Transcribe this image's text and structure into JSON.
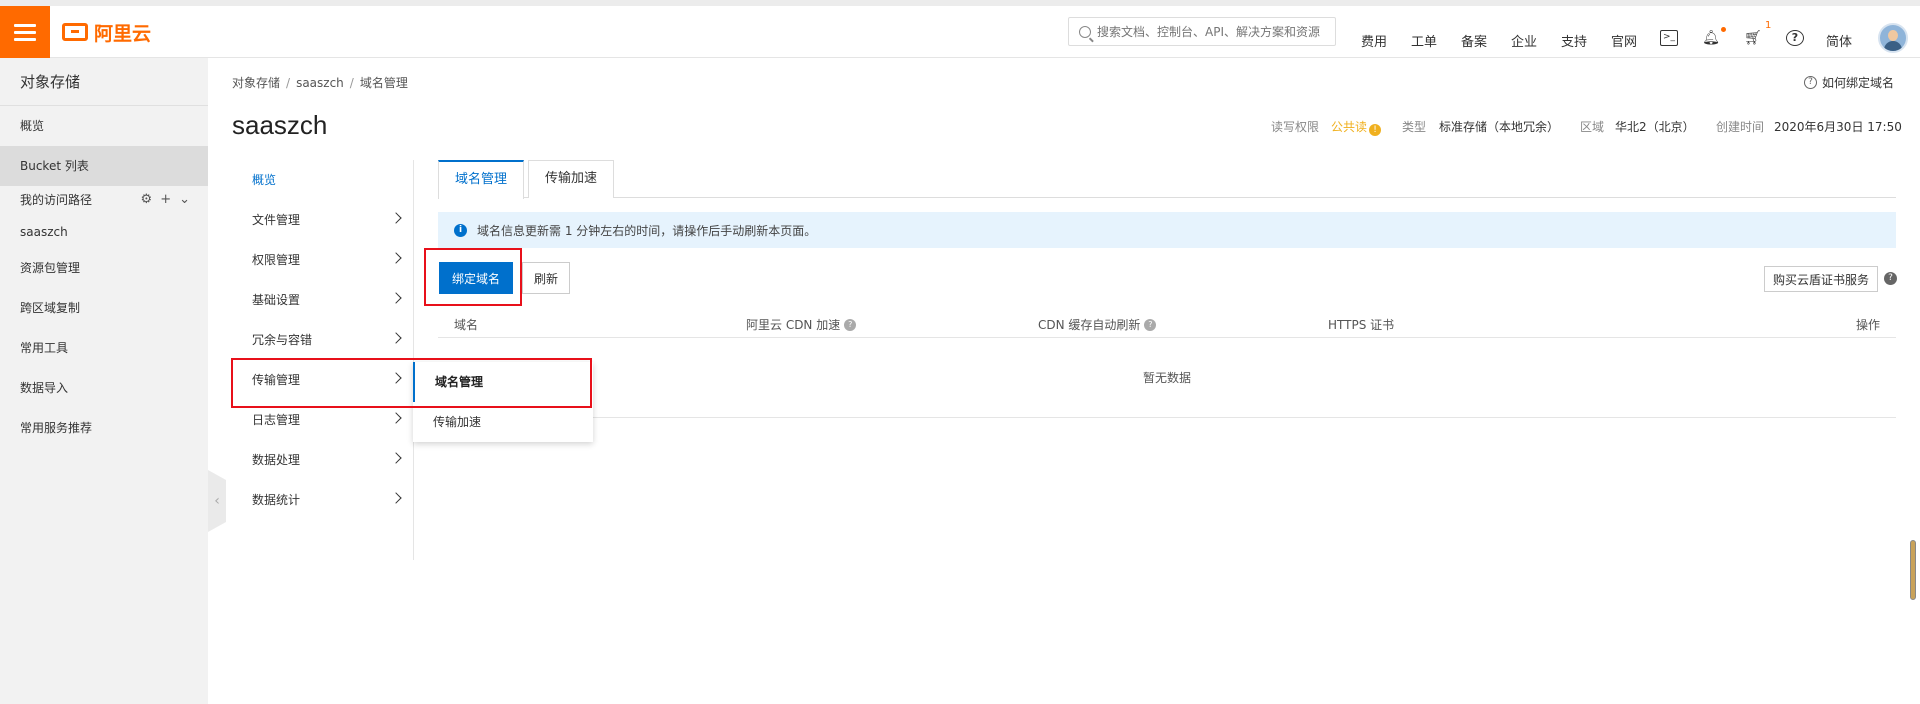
{
  "header": {
    "logo_text": "阿里云",
    "search_placeholder": "搜索文档、控制台、API、解决方案和资源",
    "nav": [
      "费用",
      "工单",
      "备案",
      "企业",
      "支持",
      "官网"
    ],
    "cart_count": "1",
    "lang": "简体"
  },
  "sidebar": {
    "title": "对象存储",
    "items": [
      "概览",
      "Bucket 列表",
      "我的访问路径",
      "saaszch",
      "资源包管理",
      "跨区域复制",
      "常用工具",
      "数据导入",
      "常用服务推荐"
    ]
  },
  "breadcrumb": [
    "对象存储",
    "saaszch",
    "域名管理"
  ],
  "help_link": "如何绑定域名",
  "bucket": {
    "name": "saaszch",
    "acl_label": "读写权限",
    "acl_value": "公共读",
    "type_label": "类型",
    "type_value": "标准存储（本地冗余）",
    "region_label": "区域",
    "region_value": "华北2（北京）",
    "created_label": "创建时间",
    "created_value": "2020年6月30日 17:50"
  },
  "inner_nav": [
    "概览",
    "文件管理",
    "权限管理",
    "基础设置",
    "冗余与容错",
    "传输管理",
    "日志管理",
    "数据处理",
    "数据统计"
  ],
  "flyout": [
    "域名管理",
    "传输加速"
  ],
  "tabs": [
    "域名管理",
    "传输加速"
  ],
  "notice": "域名信息更新需 1 分钟左右的时间，请操作后手动刷新本页面。",
  "buttons": {
    "bind": "绑定域名",
    "refresh": "刷新",
    "buy_cert": "购买云盾证书服务"
  },
  "table": {
    "columns": [
      "域名",
      "阿里云 CDN 加速",
      "CDN 缓存自动刷新",
      "HTTPS 证书",
      "操作"
    ],
    "empty": "暂无数据"
  }
}
